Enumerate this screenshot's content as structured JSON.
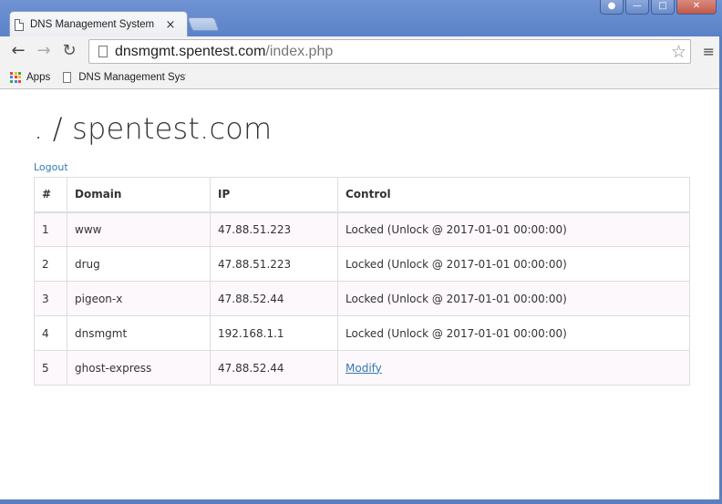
{
  "window": {
    "tab_title": "DNS Management System",
    "tab_close": "×",
    "buttons": {
      "user": "👤",
      "minimize": "—",
      "maximize": "□",
      "close": "✕"
    }
  },
  "toolbar": {
    "back_icon": "←",
    "forward_icon": "→",
    "reload_icon": "↻",
    "url_host": "dnsmgmt.spentest.com",
    "url_path": "/index.php",
    "star_icon": "☆",
    "menu_icon": "≡"
  },
  "bookmarks": {
    "apps_label": "Apps",
    "item_label": "DNS Management Syste"
  },
  "page": {
    "title": ". / spentest.com",
    "logout_label": "Logout"
  },
  "table": {
    "headers": [
      "#",
      "Domain",
      "IP",
      "Control"
    ],
    "rows": [
      {
        "num": "1",
        "domain": "www",
        "ip": "47.88.51.223",
        "control": "Locked (Unlock @ 2017-01-01 00:00:00)"
      },
      {
        "num": "2",
        "domain": "drug",
        "ip": "47.88.51.223",
        "control": "Locked (Unlock @ 2017-01-01 00:00:00)"
      },
      {
        "num": "3",
        "domain": "pigeon-x",
        "ip": "47.88.52.44",
        "control": "Locked (Unlock @ 2017-01-01 00:00:00)"
      },
      {
        "num": "4",
        "domain": "dnsmgmt",
        "ip": "192.168.1.1",
        "control": "Locked (Unlock @ 2017-01-01 00:00:00)"
      },
      {
        "num": "5",
        "domain": "ghost-express",
        "ip": "47.88.52.44",
        "control": "Modify"
      }
    ]
  },
  "colors": {
    "link": "#337ab7",
    "frame": "#5a7fbf",
    "apps_grid": [
      "#ea4335",
      "#fbbc05",
      "#34a853",
      "#4285f4",
      "#ea4335",
      "#fbbc05",
      "#34a853",
      "#4285f4",
      "#ea4335"
    ]
  }
}
